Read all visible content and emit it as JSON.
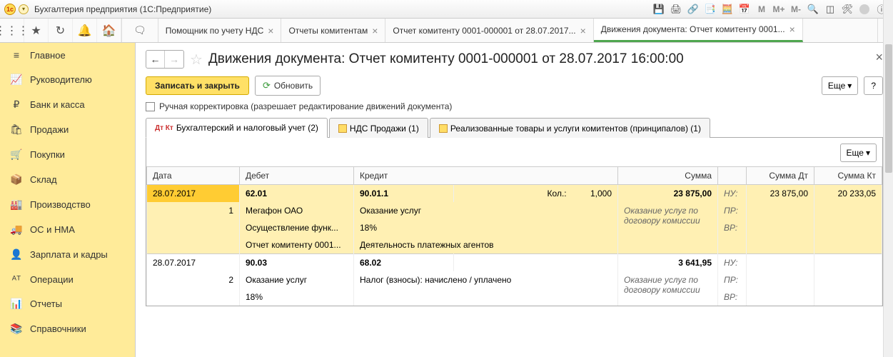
{
  "window": {
    "title": "Бухгалтерия предприятия  (1С:Предприятие)"
  },
  "editorTabs": [
    {
      "label": "Помощник по учету НДС",
      "active": false
    },
    {
      "label": "Отчеты комитентам",
      "active": false
    },
    {
      "label": "Отчет комитенту 0001-000001 от 28.07.2017...",
      "active": false
    },
    {
      "label": "Движения документа: Отчет комитенту 0001...",
      "active": true
    }
  ],
  "sidebar": {
    "items": [
      {
        "icon": "≡",
        "label": "Главное"
      },
      {
        "icon": "📈",
        "label": "Руководителю"
      },
      {
        "icon": "₽",
        "label": "Банк и касса"
      },
      {
        "icon": "🛍",
        "label": "Продажи"
      },
      {
        "icon": "🛒",
        "label": "Покупки"
      },
      {
        "icon": "📦",
        "label": "Склад"
      },
      {
        "icon": "🏭",
        "label": "Производство"
      },
      {
        "icon": "🚚",
        "label": "ОС и НМА"
      },
      {
        "icon": "👤",
        "label": "Зарплата и кадры"
      },
      {
        "icon": "ᴬᵀ",
        "label": "Операции"
      },
      {
        "icon": "📊",
        "label": "Отчеты"
      },
      {
        "icon": "📚",
        "label": "Справочники"
      }
    ]
  },
  "doc": {
    "title": "Движения документа: Отчет комитенту 0001-000001 от 28.07.2017 16:00:00",
    "save_label": "Записать и закрыть",
    "refresh_label": "Обновить",
    "more_label": "Еще",
    "help_label": "?",
    "manual_label": "Ручная корректировка (разрешает редактирование движений документа)"
  },
  "sectabs": [
    {
      "label": "Бухгалтерский и налоговый учет (2)",
      "active": true
    },
    {
      "label": "НДС Продажи (1)"
    },
    {
      "label": "Реализованные товары и услуги комитентов (принципалов) (1)"
    }
  ],
  "grid": {
    "more_label": "Еще",
    "headers": {
      "date": "Дата",
      "debit": "Дебет",
      "credit": "Кредит",
      "sum": "Сумма",
      "sumdt": "Сумма Дт",
      "sumkt": "Сумма Кт"
    },
    "labels": {
      "qty": "Кол.:",
      "nu": "НУ:",
      "pr": "ПР:",
      "vr": "ВР:"
    },
    "rows": [
      {
        "date": "28.07.2017",
        "n": "1",
        "d_acc": "62.01",
        "d_sub1": "Мегафон ОАО",
        "d_sub2": "Осуществление функ...",
        "d_sub3": "Отчет комитенту 0001...",
        "c_acc": "90.01.1",
        "c_qty": "1,000",
        "c_sub1": "Оказание услуг",
        "c_sub2": "18%",
        "c_sub3": "Деятельность платежных агентов",
        "sum": "23 875,00",
        "sum_desc": "Оказание услуг по договору комиссии",
        "sumdt": "23 875,00",
        "sumkt": "20 233,05",
        "highlight": true
      },
      {
        "date": "28.07.2017",
        "n": "2",
        "d_acc": "90.03",
        "d_sub1": "Оказание услуг",
        "d_sub2": "18%",
        "d_sub3": "",
        "c_acc": "68.02",
        "c_qty": "",
        "c_sub1": "Налог (взносы): начислено / уплачено",
        "c_sub2": "",
        "c_sub3": "",
        "sum": "3 641,95",
        "sum_desc": "Оказание услуг по договору комиссии",
        "sumdt": "",
        "sumkt": "",
        "highlight": false
      }
    ]
  }
}
